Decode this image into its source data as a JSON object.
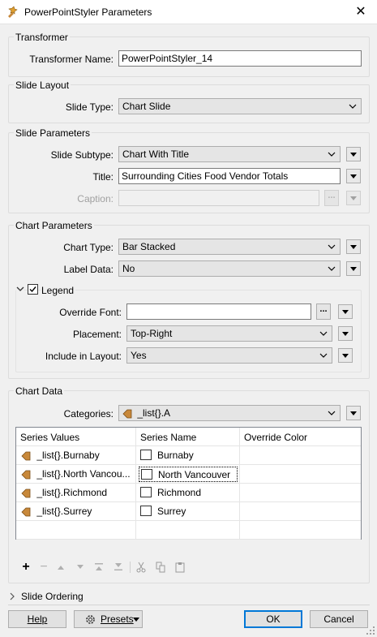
{
  "window": {
    "title": "PowerPointStyler Parameters",
    "close_glyph": "✕"
  },
  "transformer": {
    "group_title": "Transformer",
    "name_label": "Transformer Name:",
    "name_value": "PowerPointStyler_14"
  },
  "slide_layout": {
    "group_title": "Slide Layout",
    "type_label": "Slide Type:",
    "type_value": "Chart Slide"
  },
  "slide_parameters": {
    "group_title": "Slide Parameters",
    "subtype_label": "Slide Subtype:",
    "subtype_value": "Chart With Title",
    "title_label": "Title:",
    "title_value": "Surrounding Cities Food Vendor Totals",
    "caption_label": "Caption:",
    "caption_value": ""
  },
  "chart_parameters": {
    "group_title": "Chart Parameters",
    "chart_type_label": "Chart Type:",
    "chart_type_value": "Bar Stacked",
    "label_data_label": "Label Data:",
    "label_data_value": "No",
    "legend": {
      "title": "Legend",
      "checked": true,
      "override_font_label": "Override Font:",
      "override_font_value": "",
      "placement_label": "Placement:",
      "placement_value": "Top-Right",
      "include_label": "Include in Layout:",
      "include_value": "Yes"
    }
  },
  "chart_data": {
    "group_title": "Chart Data",
    "categories_label": "Categories:",
    "categories_value": "_list{}.A",
    "table": {
      "headers": [
        "Series Values",
        "Series Name",
        "Override Color"
      ],
      "rows": [
        {
          "value": "_list{}.Burnaby",
          "name": "Burnaby",
          "color": ""
        },
        {
          "value": "_list{}.North Vancou...",
          "name": "North Vancouver",
          "color": ""
        },
        {
          "value": "_list{}.Richmond",
          "name": "Richmond",
          "color": ""
        },
        {
          "value": "_list{}.Surrey",
          "name": "Surrey",
          "color": ""
        }
      ]
    }
  },
  "slide_ordering": {
    "label": "Slide Ordering"
  },
  "footer": {
    "help": "Help",
    "presets": "Presets",
    "ok": "OK",
    "cancel": "Cancel"
  },
  "colors": {
    "accent": "#0078d7",
    "attribute_icon": "#c8883a"
  }
}
